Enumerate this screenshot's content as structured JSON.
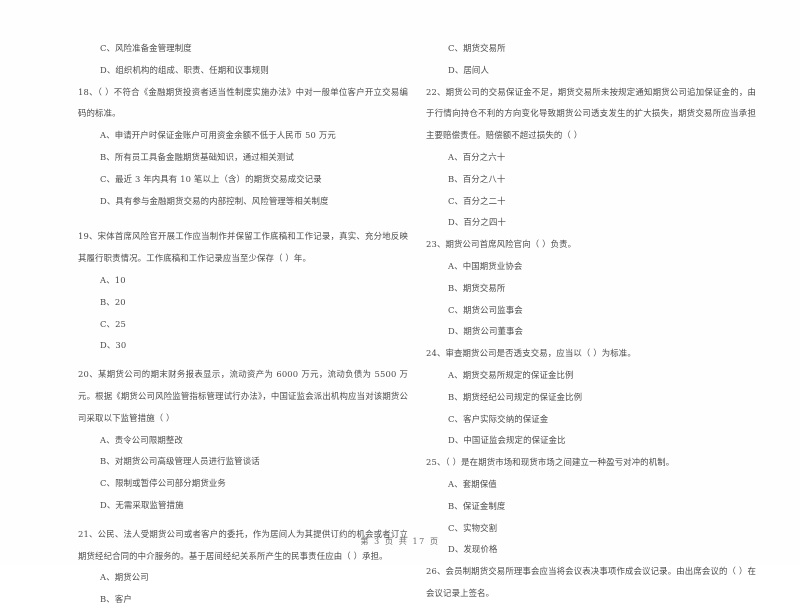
{
  "document": {
    "type": "exam-paper",
    "footer": "第 3 页 共 17 页"
  },
  "left_column": {
    "carryover_options": [
      "C、风险准备金管理制度",
      "D、组织机构的组成、职责、任期和议事规则"
    ],
    "questions": [
      {
        "number": "18",
        "stem": "18、（      ）不符合《金融期货投资者适当性制度实施办法》中对一般单位客户开立交易编码的标准。",
        "options": [
          "A、申请开户时保证金账户可用资金余额不低于人民币 50 万元",
          "B、所有员工具备金融期货基础知识，通过相关测试",
          "C、最近 3 年内具有 10 笔以上（含）的期货交易成交记录",
          "D、具有参与金融期货交易的内部控制、风险管理等相关制度"
        ]
      },
      {
        "number": "19",
        "stem": "19、宋体首席风险官开展工作应当制作并保留工作底稿和工作记录，真实、充分地反映其履行职责情况。工作底稿和工作记录应当至少保存（      ）年。",
        "options": [
          "A、10",
          "B、20",
          "C、25",
          "D、30"
        ]
      },
      {
        "number": "20",
        "stem": "20、某期货公司的期末财务报表显示，流动资产为 6000 万元，流动负债为 5500 万元。根据《期货公司风险监管指标管理试行办法》，中国证监会派出机构应当对该期货公司采取以下监管措施（      ）",
        "options": [
          "A、责令公司限期整改",
          "B、对期货公司高级管理人员进行监管谈话",
          "C、限制或暂停公司部分期货业务",
          "D、无需采取监管措施"
        ]
      },
      {
        "number": "21",
        "stem": "21、公民、法人受期货公司或者客户的委托，作为居间人为其提供订约的机会或者订立期货经纪合同的中介服务的。基于居间经纪关系所产生的民事责任应由（      ）承担。",
        "options": [
          "A、期货公司",
          "B、客户"
        ]
      }
    ]
  },
  "right_column": {
    "carryover_options": [
      "C、期货交易所",
      "D、居间人"
    ],
    "questions": [
      {
        "number": "22",
        "stem": "22、期货公司的交易保证金不足，期货交易所未按规定通知期货公司追加保证金的，由于行情向持仓不利的方向变化导致期货公司透支发生的扩大损失，期货交易所应当承担主要赔偿责任。赔偿额不超过损失的（      ）",
        "options": [
          "A、百分之六十",
          "B、百分之八十",
          "C、百分之二十",
          "D、百分之四十"
        ]
      },
      {
        "number": "23",
        "stem": "23、期货公司首席风险官向（      ）负责。",
        "options": [
          "A、中国期货业协会",
          "B、期货交易所",
          "C、期货公司监事会",
          "D、期货公司董事会"
        ]
      },
      {
        "number": "24",
        "stem": "24、审查期货公司是否透支交易，应当以（      ）为标准。",
        "options": [
          "A、期货交易所规定的保证金比例",
          "B、期货经纪公司规定的保证金比例",
          "C、客户实际交纳的保证金",
          "D、中国证监会规定的保证金比"
        ]
      },
      {
        "number": "25",
        "stem": "25、（      ）是在期货市场和现货市场之间建立一种盈亏对冲的机制。",
        "options": [
          "A、套期保值",
          "B、保证金制度",
          "C、实物交割",
          "D、发现价格"
        ]
      },
      {
        "number": "26",
        "stem": "26、会员制期货交易所理事会应当将会议表决事项作成会议记录。由出席会议的（      ）在会议记录上签名。",
        "options": []
      }
    ]
  }
}
